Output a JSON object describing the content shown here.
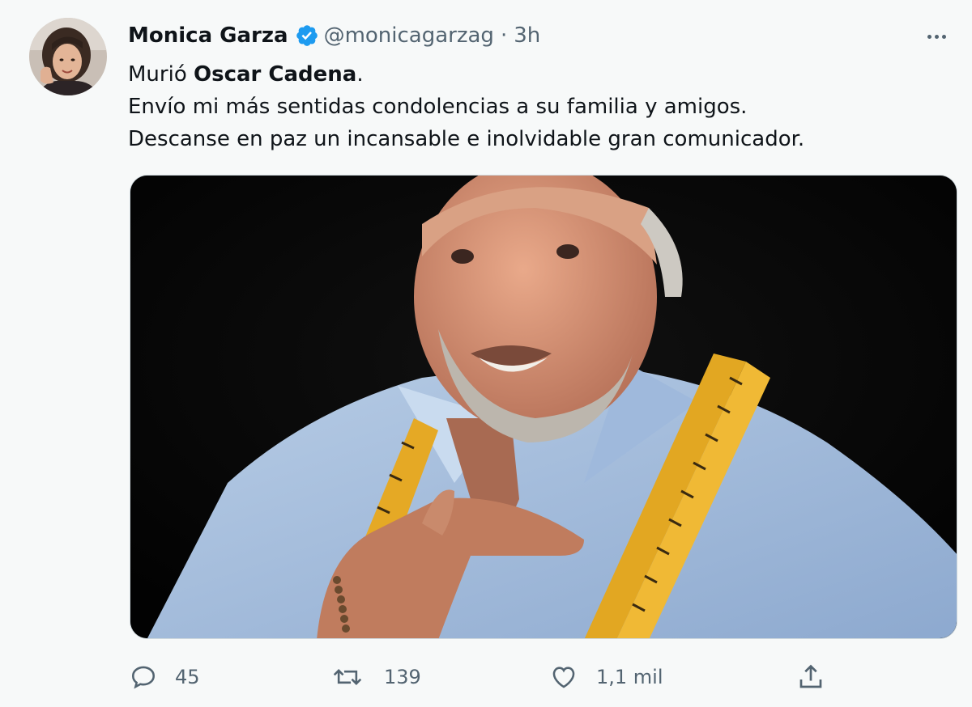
{
  "author": {
    "display_name": "Monica Garza",
    "handle": "@monicagarzag",
    "separator": "·",
    "timestamp": "3h",
    "verified": true
  },
  "tweet": {
    "line1_prefix": "Murió ",
    "line1_bold": "Oscar Cadena",
    "line1_suffix": ".",
    "line2": "Envío mi más sentidas condolencias a su familia y amigos.",
    "line3": "Descanse en paz un incansable e inolvidable gran comunicador."
  },
  "actions": {
    "reply_count": "45",
    "retweet_count": "139",
    "like_count": "1,1 mil"
  },
  "colors": {
    "verified_badge": "#1d9bf0",
    "secondary_text": "#536471",
    "primary_text": "#0f1419"
  },
  "icons": {
    "more": "more-options-icon",
    "reply": "reply-icon",
    "retweet": "retweet-icon",
    "like": "heart-icon",
    "share": "share-icon"
  }
}
